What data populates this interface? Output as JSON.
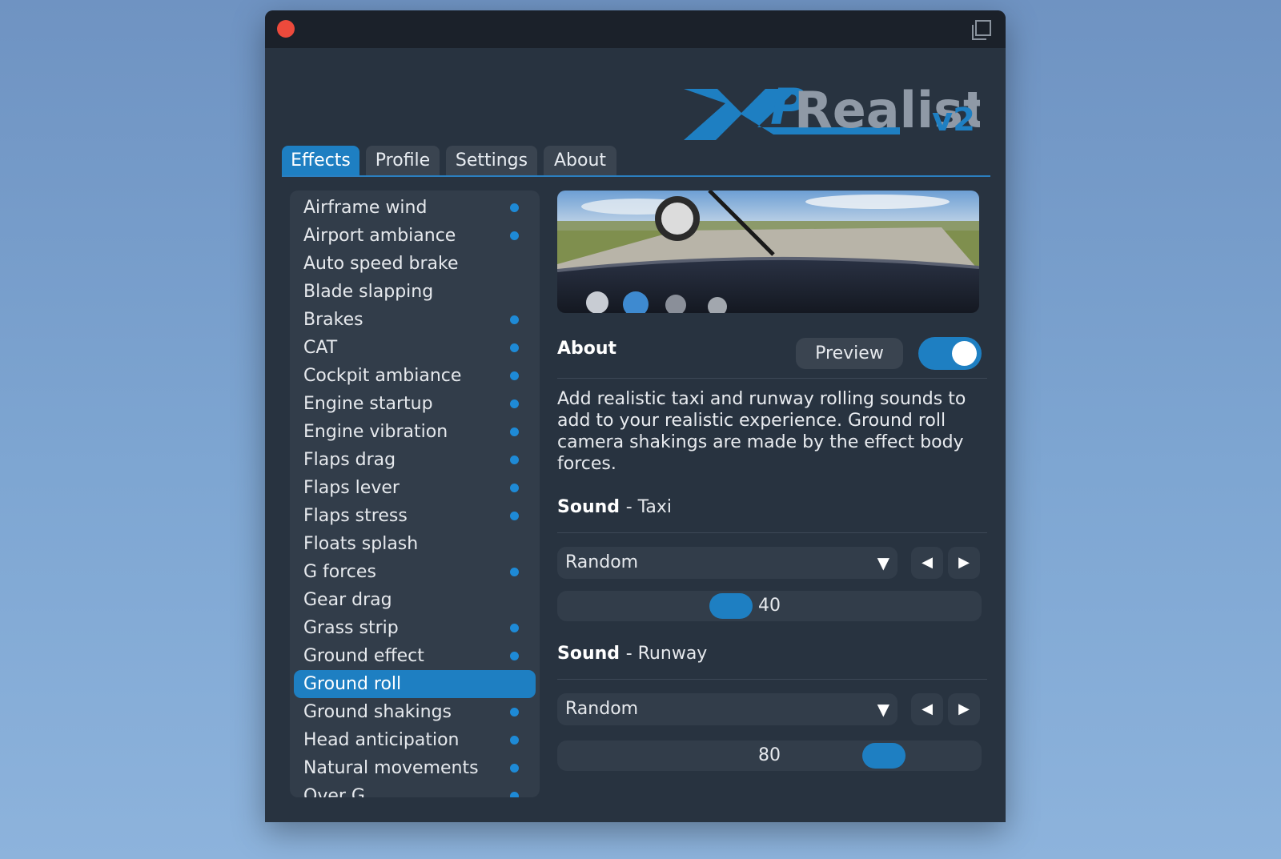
{
  "tabs": [
    {
      "label": "Effects",
      "active": true
    },
    {
      "label": "Profile",
      "active": false
    },
    {
      "label": "Settings",
      "active": false
    },
    {
      "label": "About",
      "active": false
    }
  ],
  "effects": [
    {
      "label": "Airframe wind",
      "enabled": true
    },
    {
      "label": "Airport ambiance",
      "enabled": true
    },
    {
      "label": "Auto speed brake",
      "enabled": false
    },
    {
      "label": "Blade slapping",
      "enabled": false
    },
    {
      "label": "Brakes",
      "enabled": true
    },
    {
      "label": "CAT",
      "enabled": true
    },
    {
      "label": "Cockpit ambiance",
      "enabled": true
    },
    {
      "label": "Engine startup",
      "enabled": true
    },
    {
      "label": "Engine vibration",
      "enabled": true
    },
    {
      "label": "Flaps drag",
      "enabled": true
    },
    {
      "label": "Flaps lever",
      "enabled": true
    },
    {
      "label": "Flaps stress",
      "enabled": true
    },
    {
      "label": "Floats splash",
      "enabled": false
    },
    {
      "label": "G forces",
      "enabled": true
    },
    {
      "label": "Gear drag",
      "enabled": false
    },
    {
      "label": "Grass strip",
      "enabled": true
    },
    {
      "label": "Ground effect",
      "enabled": true
    },
    {
      "label": "Ground roll",
      "enabled": true,
      "selected": true
    },
    {
      "label": "Ground shakings",
      "enabled": true
    },
    {
      "label": "Head anticipation",
      "enabled": true
    },
    {
      "label": "Natural movements",
      "enabled": true
    },
    {
      "label": "Over G",
      "enabled": true
    }
  ],
  "logo": {
    "text_a": "XP",
    "text_b": "Realistic",
    "text_c": "v2"
  },
  "about": {
    "title": "About",
    "preview_label": "Preview",
    "preview_enabled": true,
    "description": "Add realistic taxi and runway rolling sounds to add to your realistic experience. Ground roll camera shakings are made by the effect body forces."
  },
  "sound_taxi": {
    "title": "Sound",
    "subtitle": "- Taxi",
    "selected": "Random",
    "volume": 40
  },
  "sound_runway": {
    "title": "Sound",
    "subtitle": "- Runway",
    "selected": "Random",
    "volume": 80
  },
  "icons": {
    "close": "close-dot-icon",
    "popout": "popout-window-icon",
    "dropdown": "triangle-down-icon",
    "prev": "triangle-left-icon",
    "next": "triangle-right-icon"
  },
  "colors": {
    "accent": "#1e7fc2",
    "close": "#ec4a3c",
    "window_bg": "#283340"
  }
}
